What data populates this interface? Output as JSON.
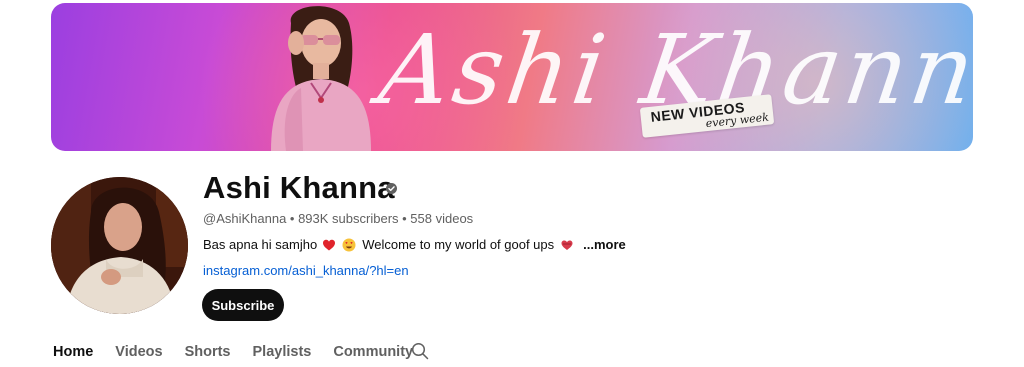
{
  "banner": {
    "script_title": "Ashi Khanna",
    "sticker_line1": "NEW VIDEOS",
    "sticker_line2": "every week"
  },
  "channel": {
    "name": "Ashi Khanna",
    "verified_icon": "verified-check-icon",
    "meta": "@AshiKhanna • 893K subscribers • 558 videos",
    "description": "Bas apna hi samjho",
    "description_tail": "Welcome to my world of goof ups",
    "more_label": "...more",
    "link": "instagram.com/ashi_khanna/?hl=en",
    "subscribe_label": "Subscribe"
  },
  "tabs": [
    {
      "label": "Home",
      "active": true
    },
    {
      "label": "Videos",
      "active": false
    },
    {
      "label": "Shorts",
      "active": false
    },
    {
      "label": "Playlists",
      "active": false
    },
    {
      "label": "Community",
      "active": false
    }
  ],
  "icons": {
    "search": "search-icon",
    "heart": "red-heart-emoji",
    "smiley": "heart-eyes-emoji",
    "heart2": "revolving-heart-emoji"
  },
  "colors": {
    "link": "#065fd4",
    "subscribe_bg": "#0f0f0f",
    "meta_text": "#606060"
  }
}
